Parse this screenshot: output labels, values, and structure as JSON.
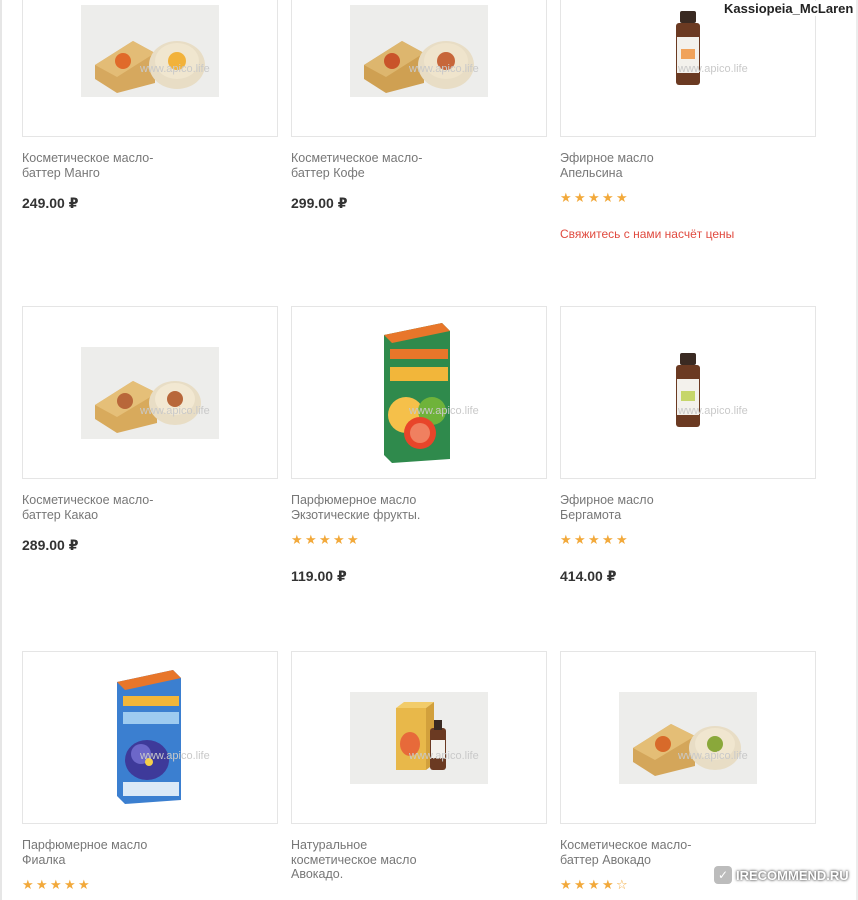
{
  "username": "Kassiopeia_McLaren",
  "watermark": "www.apico.life",
  "recommend_label": "IRECOMMEND.RU",
  "colors": {
    "star": "#f2a93b",
    "price": "#333333",
    "title": "#777777",
    "contact": "#e04a3f"
  },
  "products": [
    {
      "title_line1": "Косметическое масло-",
      "title_line2": "баттер Манго",
      "price": "249.00 ₽",
      "rating": 0
    },
    {
      "title_line1": "Косметическое масло-",
      "title_line2": "баттер Кофе",
      "price": "299.00 ₽",
      "rating": 0
    },
    {
      "title_line1": "Эфирное масло",
      "title_line2": "Апельсина",
      "rating": 5,
      "contact": "Свяжитесь с нами насчёт цены"
    },
    {
      "title_line1": "Косметическое масло-",
      "title_line2": "баттер Какао",
      "price": "289.00 ₽",
      "rating": 0
    },
    {
      "title_line1": "Парфюмерное масло",
      "title_line2": "Экзотические фрукты.",
      "price": "119.00 ₽",
      "rating": 5
    },
    {
      "title_line1": "Эфирное масло",
      "title_line2": "Бергамота",
      "price": "414.00 ₽",
      "rating": 5
    },
    {
      "title_line1": "Парфюмерное масло",
      "title_line2": "Фиалка",
      "rating": 5
    },
    {
      "title_line1": "Натуральное",
      "title_line2": "косметическое масло",
      "title_line3": "Авокадо.",
      "rating": 0
    },
    {
      "title_line1": "Косметическое масло-",
      "title_line2": "баттер Авокадо",
      "rating": 4
    }
  ]
}
